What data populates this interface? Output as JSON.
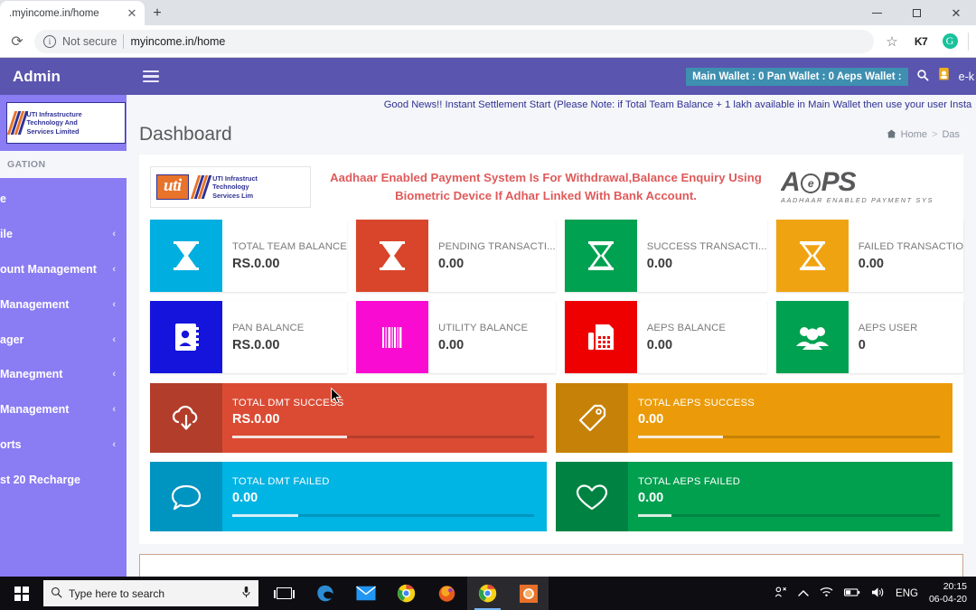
{
  "browser": {
    "tab_title": ".myincome.in/home",
    "close_glyph": "✕",
    "new_tab_glyph": "+",
    "reload_glyph": "⟳",
    "security_label": "Not secure",
    "info_glyph": "i",
    "url": "myincome.in/home",
    "star_glyph": "☆",
    "extension_label": "K7",
    "profile_glyph": "G",
    "window": {
      "minimize": "—",
      "maximize": "▢",
      "close": "✕"
    }
  },
  "app": {
    "brand": "Admin",
    "header": {
      "wallets": "Main Wallet : 0 Pan Wallet : 0 Aeps Wallet :",
      "search_glyph": "🔍",
      "ekyc_label": "e-k",
      "accent": "#5a55ae",
      "wallet_pill_bg": "#3e8fb0"
    },
    "sidebar": {
      "logo_lines": [
        "UTI Infrastructure",
        "Technology And",
        "Services Limited"
      ],
      "section_label": "GATION",
      "caret_glyph": "‹",
      "bg": "#8a7cf3",
      "items": [
        {
          "label": "e",
          "caret": false
        },
        {
          "label": "ile",
          "caret": true
        },
        {
          "label": "ount Management",
          "caret": true
        },
        {
          "label": " Management",
          "caret": true
        },
        {
          "label": "ager",
          "caret": true
        },
        {
          "label": "Manegment",
          "caret": true
        },
        {
          "label": "Management",
          "caret": true
        },
        {
          "label": "orts",
          "caret": true
        },
        {
          "label": "st 20 Recharge",
          "caret": false
        }
      ]
    },
    "marquee": "Good News!! Instant Settlement Start (Please Note: if Total Team Balance + 1 lakh available in Main Wallet then use your user Insta",
    "page_title": "Dashboard",
    "breadcrumb": {
      "home_icon": "home-icon",
      "home": "Home",
      "separator": ">",
      "current": "Das"
    },
    "promo": {
      "uti_badge": "uti",
      "uti_lines": [
        "UTI Infrastruct",
        "Technology",
        "Services Lim"
      ],
      "message": "Aadhaar Enabled Payment System Is For Withdrawal,Balance Enquiry Using Biometric Device If Adhar Linked With Bank Account.",
      "message_color": "#e05a5a",
      "aeps_title": "A  PS",
      "aeps_sub": "AADHAAR ENABLED PAYMENT SYS",
      "aeps_mark": "e"
    },
    "stat_cards": [
      {
        "label": "TOTAL TEAM BALANCE",
        "value": "RS.0.00",
        "color": "#00aee0",
        "icon": "hourglass-icon"
      },
      {
        "label": "PENDING TRANSACTI...",
        "value": "0.00",
        "color": "#d9452a",
        "icon": "hourglass-icon"
      },
      {
        "label": "SUCCESS TRANSACTI...",
        "value": "0.00",
        "color": "#00a150",
        "icon": "hourglass-icon"
      },
      {
        "label": "FAILED TRANSACTIO",
        "value": "0.00",
        "color": "#f0a311",
        "icon": "hourglass-icon"
      },
      {
        "label": "PAN BALANCE",
        "value": "RS.0.00",
        "color": "#1414dd",
        "icon": "contact-book-icon"
      },
      {
        "label": "UTILITY BALANCE",
        "value": "0.00",
        "color": "#f90bd2",
        "icon": "barcode-icon"
      },
      {
        "label": "AEPS BALANCE",
        "value": "0.00",
        "color": "#ef0000",
        "icon": "fax-machine-icon"
      },
      {
        "label": "AEPS USER",
        "value": "0",
        "color": "#00a150",
        "icon": "users-group-icon"
      }
    ],
    "wide_cards": [
      {
        "label": "TOTAL DMT SUCCESS",
        "value": "RS.0.00",
        "color": "#db4b34",
        "icon_bg": "#b23d2a",
        "progress": 38,
        "icon": "cloud-download-icon"
      },
      {
        "label": "TOTAL AEPS SUCCESS",
        "value": "0.00",
        "color": "#eb9b09",
        "icon_bg": "#c68208",
        "progress": 28,
        "icon": "tag-icon"
      },
      {
        "label": "TOTAL DMT FAILED",
        "value": "0.00",
        "color": "#00b4e4",
        "icon_bg": "#0094c0",
        "progress": 22,
        "icon": "chat-bubble-icon"
      },
      {
        "label": "TOTAL AEPS FAILED",
        "value": "0.00",
        "color": "#00a04f",
        "icon_bg": "#008342",
        "progress": 11,
        "icon": "heart-icon"
      }
    ]
  },
  "taskbar": {
    "start_icon": "windows-logo-icon",
    "search_placeholder": "Type here to search",
    "search_glyph": "◯",
    "mic_glyph": "🎤",
    "apps": [
      {
        "name": "task-view-icon"
      },
      {
        "name": "edge-icon"
      },
      {
        "name": "mail-icon"
      },
      {
        "name": "chrome-icon"
      },
      {
        "name": "firefox-icon"
      },
      {
        "name": "chrome-active-icon"
      },
      {
        "name": "vlc-icon"
      }
    ],
    "tray": {
      "people_glyph": "ᚴ",
      "chevron_glyph": "︿",
      "wifi_glyph": "◟",
      "battery_glyph": "▭",
      "volume_glyph": "🔊",
      "language": "ENG",
      "time": "20:15",
      "date": "06-04-20"
    }
  }
}
